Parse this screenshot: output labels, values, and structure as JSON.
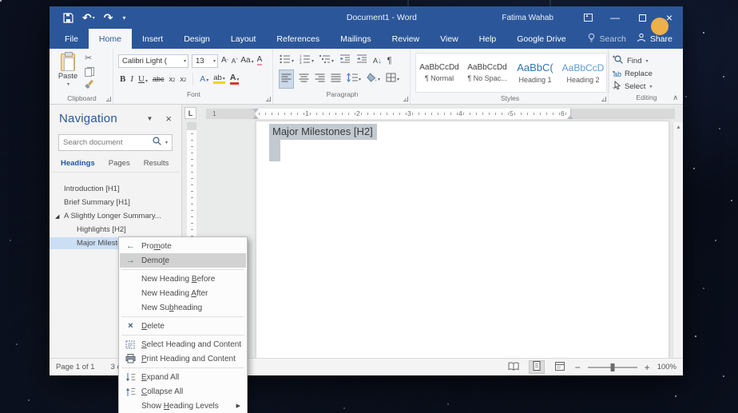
{
  "colors": {
    "accent": "#2b579a",
    "nav_selection": "#cbdff4",
    "doc_selection": "#c2c9d1",
    "recording_dot": "#eeb04a",
    "heading1_blue": "#2e74b5",
    "heading2_blue": "#5b9bd5"
  },
  "titlebar": {
    "title": "Document1 - Word",
    "user": "Fatima Wahab",
    "minimize_glyph": "—",
    "close_glyph": "×",
    "undo_glyph": "↶",
    "redo_glyph": "↷"
  },
  "tabs": [
    {
      "label": "File",
      "kind": "file"
    },
    {
      "label": "Home",
      "kind": "active"
    },
    {
      "label": "Insert"
    },
    {
      "label": "Design"
    },
    {
      "label": "Layout"
    },
    {
      "label": "References"
    },
    {
      "label": "Mailings"
    },
    {
      "label": "Review"
    },
    {
      "label": "View"
    },
    {
      "label": "Help"
    },
    {
      "label": "Google Drive"
    },
    {
      "label": "Search",
      "kind": "tellme"
    }
  ],
  "share_label": "Share",
  "ribbon": {
    "clipboard": {
      "label": "Clipboard",
      "paste": "Paste"
    },
    "font": {
      "label": "Font",
      "font_name": "Calibri Light (",
      "font_size": "13",
      "grow": "A",
      "shrink": "A",
      "case_btn": "Aa",
      "clear": "A",
      "bold": "B",
      "italic": "I",
      "underline": "U",
      "strike": "abc",
      "subscript": "x",
      "superscript": "x",
      "effects": "A",
      "highlight": "ab",
      "fontcolor": "A"
    },
    "paragraph": {
      "label": "Paragraph",
      "sort_a": "A",
      "pilcrow": "¶"
    },
    "styles": {
      "label": "Styles",
      "items": [
        {
          "sample": "AaBbCcDd",
          "name": "¶ Normal",
          "color": "#3f3f3f",
          "size": "10px"
        },
        {
          "sample": "AaBbCcDd",
          "name": "¶ No Spac...",
          "color": "#3f3f3f",
          "size": "10px"
        },
        {
          "sample": "AaBbC(",
          "name": "Heading 1",
          "color": "#2e74b5",
          "size": "13px"
        },
        {
          "sample": "AaBbCcD",
          "name": "Heading 2",
          "color": "#5b9bd5",
          "size": "12px"
        }
      ]
    },
    "editing": {
      "label": "Editing",
      "find": "Find",
      "replace": "Replace",
      "select": "Select"
    }
  },
  "navigation": {
    "title": "Navigation",
    "search_placeholder": "Search document",
    "tabs": [
      {
        "label": "Headings",
        "active": true
      },
      {
        "label": "Pages"
      },
      {
        "label": "Results"
      }
    ],
    "headings": [
      {
        "label": "Introduction [H1]",
        "level": 1
      },
      {
        "label": "Brief Summary [H1]",
        "level": 1
      },
      {
        "label": "A Slightly Longer Summary...",
        "level": 1,
        "expander": "◢"
      },
      {
        "label": "Highlights [H2]",
        "level": 2
      },
      {
        "label": "Major Milestones...",
        "level": 2,
        "selected": true
      }
    ]
  },
  "document": {
    "heading_text": "Major Milestones [H2]",
    "ruler_margin_number": "1",
    "ruler_numbers": [
      "1",
      "2",
      "3",
      "4",
      "5",
      "6"
    ],
    "tab_selector": "L"
  },
  "statusbar": {
    "page": "Page 1 of 1",
    "words": "3 of 15",
    "zoom": "100%",
    "zoom_out": "−",
    "zoom_in": "+"
  },
  "context_menu": {
    "items": [
      {
        "label": "Pro&mote",
        "icon": "arrow-left"
      },
      {
        "label": "Demo&te",
        "icon": "arrow-right",
        "highlighted": true
      },
      {
        "sep": true
      },
      {
        "label": "New Heading &Before"
      },
      {
        "label": "New Heading &After"
      },
      {
        "label": "New Su&bheading"
      },
      {
        "sep": true
      },
      {
        "label": "&Delete",
        "icon": "delete-x"
      },
      {
        "sep": true
      },
      {
        "label": "&Select Heading and Content",
        "icon": "select-content"
      },
      {
        "label": "&Print Heading and Content",
        "icon": "printer"
      },
      {
        "sep": true
      },
      {
        "label": "&Expand All",
        "icon": "expand-all"
      },
      {
        "label": "&Collapse All",
        "icon": "collapse-all"
      },
      {
        "label": "Show &Heading Levels",
        "submenu": true
      }
    ]
  }
}
